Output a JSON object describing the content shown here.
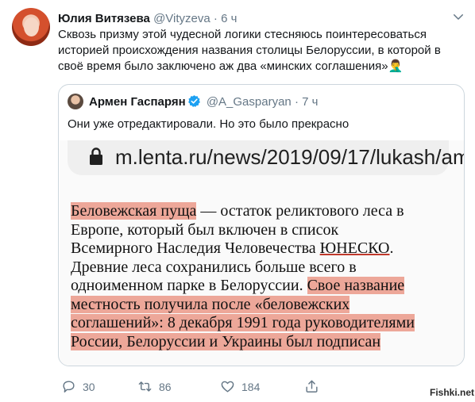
{
  "tweet": {
    "author_name": "Юлия Витязева",
    "author_handle": "@Vityzeva",
    "separator": "·",
    "time": "6 ч",
    "text_lines": [
      "Сквозь призму этой чудесной логики стесняюсь поинтересоваться",
      "историей происхождения названия столицы Белоруссии, в которой в",
      "своё время было заключено аж два «минских соглашения»🤦‍♂️"
    ],
    "reply_count": "30",
    "retweet_count": "86",
    "like_count": "184"
  },
  "quoted": {
    "author_name": "Армен Гаспарян",
    "author_handle": "@A_Gasparyan",
    "separator": "·",
    "time": "7 ч",
    "text": "Они уже отредактировали. Но это было прекрасно",
    "screenshot": {
      "url": "m.lenta.ru/news/2019/09/17/lukash/am",
      "lines": [
        {
          "parts": [
            {
              "t": "Беловежская пуща",
              "hl": true
            },
            {
              "t": " — остаток реликтового леса в",
              "hl": false
            }
          ]
        },
        {
          "parts": [
            {
              "t": "Европе, который был включен в список",
              "hl": false
            }
          ]
        },
        {
          "parts": [
            {
              "t": "Всемирного Наследия Человечества ",
              "hl": false
            },
            {
              "t": "ЮНЕСКО",
              "hl": false,
              "ul": true
            },
            {
              "t": ".",
              "hl": false
            }
          ]
        },
        {
          "parts": [
            {
              "t": "Древние леса сохранились больше всего в",
              "hl": false
            }
          ]
        },
        {
          "parts": [
            {
              "t": "одноименном парке в Белоруссии. ",
              "hl": false
            },
            {
              "t": "Свое название",
              "hl": true
            }
          ]
        },
        {
          "parts": [
            {
              "t": "местность получила после «беловежских",
              "hl": true
            }
          ]
        },
        {
          "parts": [
            {
              "t": "соглашений»: 8 декабря 1991 года руководителями",
              "hl": true
            }
          ]
        },
        {
          "parts": [
            {
              "t": "России, Белоруссии и Украины был подписан",
              "hl": true
            }
          ]
        }
      ]
    }
  },
  "watermark": "Fishki.net",
  "colors": {
    "text": "#14171a",
    "secondary": "#657786",
    "border": "#ccd6dd",
    "verified": "#1da1f2",
    "highlight": "#e26348"
  },
  "icons": {
    "reply": "speech-bubble-icon",
    "retweet": "retweet-icon",
    "like": "heart-icon",
    "caret": "chevron-down-icon",
    "verified": "verified-badge-icon",
    "lock": "lock-icon"
  }
}
